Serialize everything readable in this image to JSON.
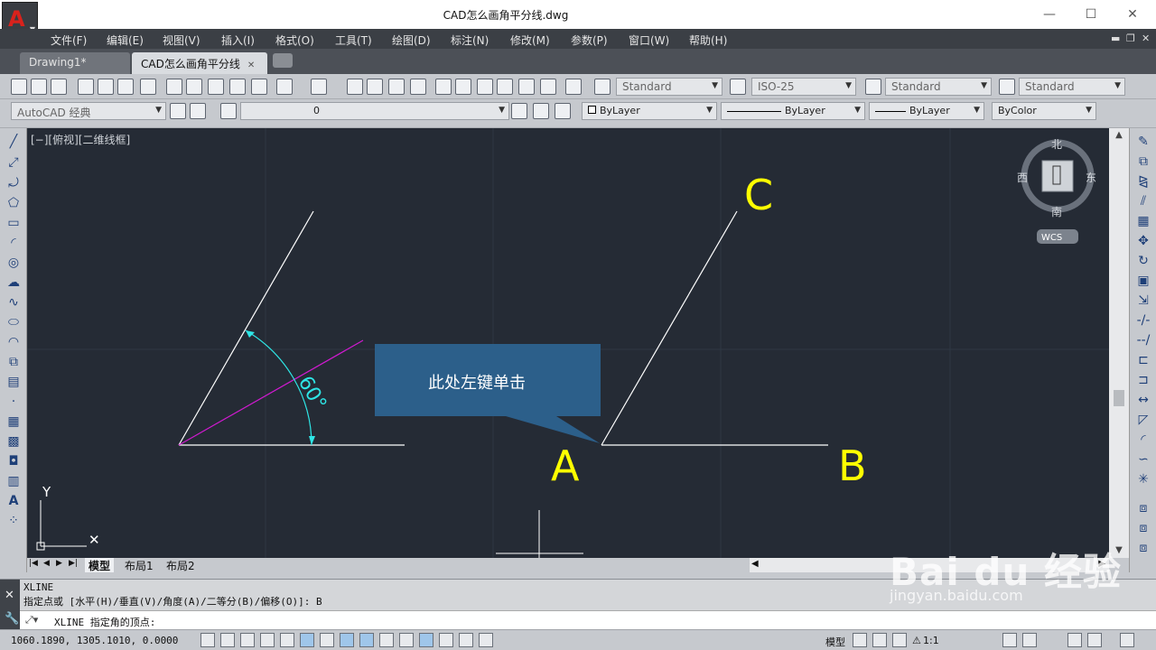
{
  "window": {
    "title": "CAD怎么画角平分线.dwg",
    "controls": [
      "—",
      "☐",
      "✕"
    ]
  },
  "menu": [
    "文件(F)",
    "编辑(E)",
    "视图(V)",
    "插入(I)",
    "格式(O)",
    "工具(T)",
    "绘图(D)",
    "标注(N)",
    "修改(M)",
    "参数(P)",
    "窗口(W)",
    "帮助(H)"
  ],
  "tabs": [
    {
      "label": "Drawing1*"
    },
    {
      "label": "CAD怎么画角平分线"
    }
  ],
  "styles": {
    "text_style": "Standard",
    "dim_style": "ISO-25",
    "table_style": "Standard",
    "multileader_style": "Standard"
  },
  "workspace": "AutoCAD 经典",
  "layer": "0",
  "properties": {
    "color": "ByLayer",
    "linetype": "ByLayer",
    "lineweight": "ByLayer",
    "plotstyle": "ByColor"
  },
  "viewport": {
    "label": "[−][俯视][二维线框]"
  },
  "drawing": {
    "angle_label": "60°",
    "point_a": "A",
    "point_b": "B",
    "point_c": "C",
    "callout_text": "此处左键单击",
    "ucs_y": "Y",
    "colors": {
      "background": "#252b35",
      "lines": "#ffffff",
      "bisector": "#d01ad0",
      "dimension": "#2ee6e6",
      "labels": "#ffff00",
      "callout": "#2c5f8a"
    }
  },
  "viewcube": {
    "north": "北",
    "south": "南",
    "east": "东",
    "west": "西",
    "wcs": "WCS"
  },
  "layout_tabs": [
    "模型",
    "布局1",
    "布局2"
  ],
  "command": {
    "history": [
      "XLINE",
      "指定点或 [水平(H)/垂直(V)/角度(A)/二等分(B)/偏移(O)]: B"
    ],
    "current": "XLINE 指定角的顶点:"
  },
  "status": {
    "coordinates": "1060.1890, 1305.1010, 0.0000",
    "model": "模型",
    "scale": "1:1"
  },
  "watermark": {
    "main": "Bai du 经验",
    "sub": "jingyan.baidu.com"
  }
}
